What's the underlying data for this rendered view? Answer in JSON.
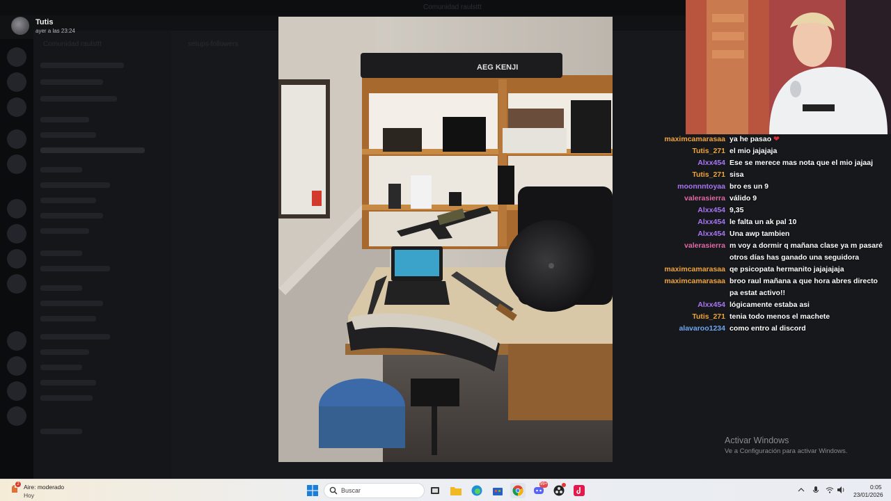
{
  "app": {
    "window_title": "Comunidad raulsttt",
    "server_name": "Comunidad raulsttt",
    "channel_name": "setups-followers"
  },
  "post": {
    "username": "Tutis",
    "timestamp": "ayer a las 23:24"
  },
  "chat": {
    "messages": [
      {
        "user": "maximcamarasaa",
        "text": "ya he pasao",
        "heart": true,
        "color": "#f0a43a"
      },
      {
        "user": "Tutis_271",
        "text": "el mio jajajaja",
        "color": "#f0a43a"
      },
      {
        "user": "Alxx454",
        "text": "Ese se merece mas nota que el mio jajaaj",
        "color": "#a876f5"
      },
      {
        "user": "Tutis_271",
        "text": "sisa",
        "color": "#f0a43a"
      },
      {
        "user": "moonnntoyaa",
        "text": "bro es un 9",
        "color": "#a876f5"
      },
      {
        "user": "valerasierra",
        "text": "válido 9",
        "color": "#e06aa5"
      },
      {
        "user": "Alxx454",
        "text": "9,35",
        "color": "#a876f5"
      },
      {
        "user": "Alxx454",
        "text": "le falta un ak pal 10",
        "color": "#a876f5"
      },
      {
        "user": "Alxx454",
        "text": "Una awp tambien",
        "color": "#a876f5"
      },
      {
        "user": "valerasierra",
        "text": "m voy a dormir q mañana clase ya m pasaré otros días has ganado una seguidora",
        "color": "#e06aa5"
      },
      {
        "user": "maximcamarasaa",
        "text": "qe psicopata hermanito jajajajaja",
        "color": "#f0a43a"
      },
      {
        "user": "maximcamarasaa",
        "text": "broo raul mañana a que hora abres directo pa estat activo!!",
        "color": "#f0a43a"
      },
      {
        "user": "Alxx454",
        "text": "lógicamente estaba asi",
        "color": "#a876f5"
      },
      {
        "user": "Tutis_271",
        "text": "tenia todo menos el machete",
        "color": "#f0a43a"
      },
      {
        "user": "alavaroo1234",
        "text": "como entro al discord",
        "color": "#6fa6ef"
      }
    ]
  },
  "photo": {
    "box_label": "AEG KENJI"
  },
  "watermark": {
    "title": "Activar Windows",
    "subtitle": "Ve a Configuración para activar Windows."
  },
  "taskbar": {
    "weather_title": "Aire: moderado",
    "weather_sub": "Hoy",
    "weather_badge": "2",
    "search_placeholder": "Buscar",
    "time": "0:05",
    "date": "23/01/2026",
    "discord_badge": "99+"
  },
  "colors": {
    "accent_orange": "#f0a43a",
    "accent_purple": "#a876f5",
    "accent_pink": "#e06aa5",
    "accent_blue": "#6fa6ef"
  }
}
